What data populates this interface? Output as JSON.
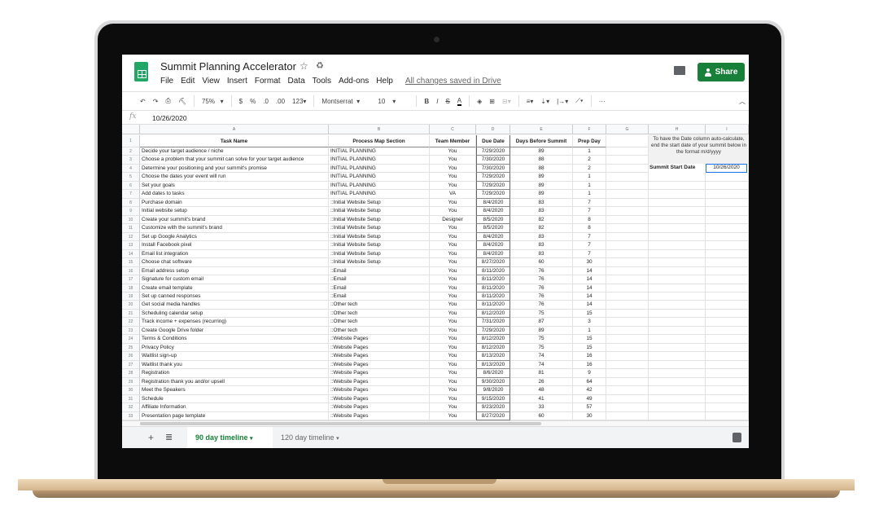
{
  "app": {
    "title": "Summit Planning Accelerator",
    "menu": [
      "File",
      "Edit",
      "View",
      "Insert",
      "Format",
      "Data",
      "Tools",
      "Add-ons",
      "Help"
    ],
    "saved_status": "All changes saved in Drive",
    "share_label": "Share"
  },
  "toolbar": {
    "zoom": "75%",
    "currency": "$",
    "percent": "%",
    "dec_less": ".0",
    "dec_more": ".00",
    "format_more": "123",
    "font": "Montserrat",
    "font_size": "10",
    "bold": "B",
    "italic": "I",
    "strike": "S",
    "text_color": "A",
    "more": "···"
  },
  "formula_bar": {
    "fx": "fx",
    "value": "10/26/2020"
  },
  "columns": [
    "A",
    "B",
    "C",
    "D",
    "E",
    "F",
    "G",
    "H",
    "I"
  ],
  "headers": [
    "Task Name",
    "Process Map Section",
    "Team Member",
    "Due Date",
    "Days Before Summit",
    "Prep Day"
  ],
  "rows": [
    [
      "Decide your target audience / niche",
      "INITIAL PLANNING",
      "You",
      "7/29/2020",
      "89",
      "1"
    ],
    [
      "Choose a problem that your summit can solve for your target audience",
      "INITIAL PLANNING",
      "You",
      "7/30/2020",
      "88",
      "2"
    ],
    [
      "Determine your positioning and your summit's promise",
      "INITIAL PLANNING",
      "You",
      "7/30/2020",
      "88",
      "2"
    ],
    [
      "Choose the dates your event will run",
      "INITIAL PLANNING",
      "You",
      "7/29/2020",
      "89",
      "1"
    ],
    [
      "Set your goals",
      "INITIAL PLANNING",
      "You",
      "7/29/2020",
      "89",
      "1"
    ],
    [
      "Add dates to tasks",
      "INITIAL PLANNING",
      "VA",
      "7/29/2020",
      "89",
      "1"
    ],
    [
      "Purchase domain",
      "::Initial Website Setup",
      "You",
      "8/4/2020",
      "83",
      "7"
    ],
    [
      "Initial website setup",
      "::Initial Website Setup",
      "You",
      "8/4/2020",
      "83",
      "7"
    ],
    [
      "Create your summit's brand",
      "::Initial Website Setup",
      "Designer",
      "8/5/2020",
      "82",
      "8"
    ],
    [
      "Customize with the summit's brand",
      "::Initial Website Setup",
      "You",
      "8/5/2020",
      "82",
      "8"
    ],
    [
      "Set up Google Analytics",
      "::Initial Website Setup",
      "You",
      "8/4/2020",
      "83",
      "7"
    ],
    [
      "Install Facebook pixel",
      "::Initial Website Setup",
      "You",
      "8/4/2020",
      "83",
      "7"
    ],
    [
      "Email list integration",
      "::Initial Website Setup",
      "You",
      "8/4/2020",
      "83",
      "7"
    ],
    [
      "Choose chat software",
      "::Initial Website Setup",
      "You",
      "8/27/2020",
      "60",
      "30"
    ],
    [
      "Email address setup",
      "::Email",
      "You",
      "8/11/2020",
      "76",
      "14"
    ],
    [
      "Signature for custom email",
      "::Email",
      "You",
      "8/11/2020",
      "76",
      "14"
    ],
    [
      "Create email template",
      "::Email",
      "You",
      "8/11/2020",
      "76",
      "14"
    ],
    [
      "Set up canned responses",
      "::Email",
      "You",
      "8/11/2020",
      "76",
      "14"
    ],
    [
      "Get social media handles",
      "::Other tech",
      "You",
      "8/11/2020",
      "76",
      "14"
    ],
    [
      "Scheduling calendar setup",
      "::Other tech",
      "You",
      "8/12/2020",
      "75",
      "15"
    ],
    [
      "Track income + expenses (recurring)",
      "::Other tech",
      "You",
      "7/31/2020",
      "87",
      "3"
    ],
    [
      "Create Google Drive folder",
      "::Other tech",
      "You",
      "7/29/2020",
      "89",
      "1"
    ],
    [
      "Terms & Conditions",
      "::Website Pages",
      "You",
      "8/12/2020",
      "75",
      "15"
    ],
    [
      "Privacy Policy",
      "::Website Pages",
      "You",
      "8/12/2020",
      "75",
      "15"
    ],
    [
      "Waitlist sign-up",
      "::Website Pages",
      "You",
      "8/13/2020",
      "74",
      "16"
    ],
    [
      "Waitlist thank you",
      "::Website Pages",
      "You",
      "8/13/2020",
      "74",
      "16"
    ],
    [
      "Registration",
      "::Website Pages",
      "You",
      "8/6/2020",
      "81",
      "9"
    ],
    [
      "Registration thank you and/or upsell",
      "::Website Pages",
      "You",
      "9/30/2020",
      "26",
      "64"
    ],
    [
      "Meet the Speakers",
      "::Website Pages",
      "You",
      "9/8/2020",
      "48",
      "42"
    ],
    [
      "Schedule",
      "::Website Pages",
      "You",
      "9/15/2020",
      "41",
      "49"
    ],
    [
      "Affiliate Information",
      "::Website Pages",
      "You",
      "9/23/2020",
      "33",
      "57"
    ],
    [
      "Presentation page template",
      "::Website Pages",
      "You",
      "8/27/2020",
      "60",
      "30"
    ]
  ],
  "side_note": {
    "instructions": "To have the Date column auto-calculate, end the start date of your summit below in the format m/d/yyyy",
    "label": "Summit Start Date",
    "value": "10/26/2020"
  },
  "sheet_tabs": [
    {
      "label": "90 day timeline",
      "active": true
    },
    {
      "label": "120 day timeline",
      "active": false
    }
  ],
  "colors": {
    "brand": "#188038",
    "selection": "#1a73e8"
  }
}
